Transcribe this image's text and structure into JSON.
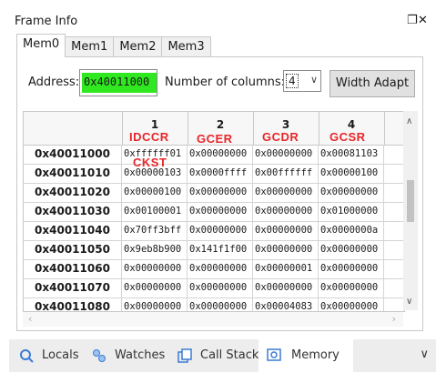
{
  "window": {
    "title": "Frame Info",
    "icons": [
      "float-window-icon",
      "close-icon"
    ]
  },
  "tabs": [
    "Mem0",
    "Mem1",
    "Mem2",
    "Mem3"
  ],
  "active_tab": "Mem0",
  "toolbar": {
    "address_label": "Address:",
    "address_value": "0x40011000",
    "columns_label": "Number of columns:",
    "columns_value": "4",
    "width_adapt_label": "Width Adapt"
  },
  "grid": {
    "column_headers": [
      "1",
      "2",
      "3",
      "4"
    ],
    "rows": [
      {
        "addr": "0x40011000",
        "values": [
          "0xffffff01",
          "0x00000000",
          "0x00000000",
          "0x00081103"
        ]
      },
      {
        "addr": "0x40011010",
        "values": [
          "0x00000103",
          "0x0000ffff",
          "0x00ffffff",
          "0x00000100"
        ]
      },
      {
        "addr": "0x40011020",
        "values": [
          "0x00000100",
          "0x00000000",
          "0x00000000",
          "0x00000000"
        ]
      },
      {
        "addr": "0x40011030",
        "values": [
          "0x00100001",
          "0x00000000",
          "0x00000000",
          "0x01000000"
        ]
      },
      {
        "addr": "0x40011040",
        "values": [
          "0x70ff3bff",
          "0x00000000",
          "0x00000000",
          "0x0000000a"
        ]
      },
      {
        "addr": "0x40011050",
        "values": [
          "0x9eb8b900",
          "0x141f1f00",
          "0x00000000",
          "0x00000000"
        ]
      },
      {
        "addr": "0x40011060",
        "values": [
          "0x00000000",
          "0x00000000",
          "0x00000001",
          "0x00000000"
        ]
      },
      {
        "addr": "0x40011070",
        "values": [
          "0x00000000",
          "0x00000000",
          "0x00000000",
          "0x00000000"
        ]
      },
      {
        "addr": "0x40011080",
        "values": [
          "0x00000000",
          "0x00000000",
          "0x00004083",
          "0x00000000"
        ]
      }
    ]
  },
  "annotations": {
    "idccr": "IDCCR",
    "gcer": "GCER",
    "gcdr": "GCDR",
    "gcsr": "GCSR",
    "ckst": "CKST",
    "color": "#e8262a"
  },
  "highlight_color": "#2fe81f",
  "bottom_tabs": [
    {
      "label": "Locals",
      "icon": "locals-icon"
    },
    {
      "label": "Watches",
      "icon": "watches-icon"
    },
    {
      "label": "Call Stack",
      "icon": "call-stack-icon"
    },
    {
      "label": "Memory",
      "icon": "memory-icon"
    }
  ],
  "active_bottom_tab": "Memory"
}
